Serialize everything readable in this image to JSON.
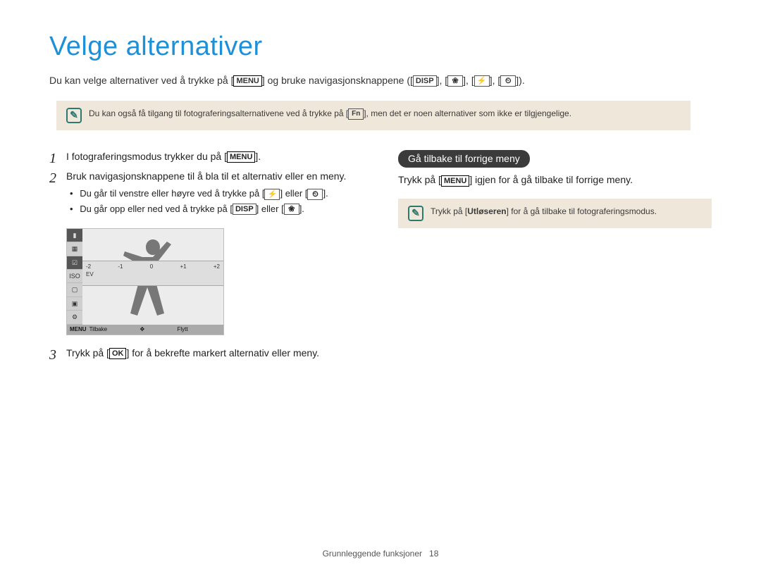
{
  "title": "Velge alternativer",
  "intro": {
    "part1": "Du kan velge alternativer ved å trykke på [",
    "menu": "MENU",
    "part2": "] og bruke navigasjonsknappene ([",
    "disp": "DISP",
    "part3": "], [",
    "macro": "❀",
    "part4": "], [",
    "flash": "⚡",
    "part5": "], [",
    "timer": "⏲",
    "part6": "])."
  },
  "note1": {
    "part1": "Du kan også få tilgang til fotograferingsalternativene ved å trykke på [",
    "fn": "Fn",
    "part2": "], men det er noen alternativer som ikke er tilgjengelige."
  },
  "steps": {
    "s1": {
      "num": "1",
      "text1": "I fotograferingsmodus trykker du på [",
      "menu": "MENU",
      "text2": "]."
    },
    "s2": {
      "num": "2",
      "text": "Bruk navigasjonsknappene til å bla til et alternativ eller en meny.",
      "b1a": "Du går til venstre eller høyre ved å trykke på [",
      "b1_icon1": "⚡",
      "b1b": "] eller [",
      "b1_icon2": "⏲",
      "b1c": "].",
      "b2a": "Du går opp eller ned ved å trykke på [",
      "b2_icon1": "DISP",
      "b2b": "] eller [",
      "b2_icon2": "❀",
      "b2c": "]."
    },
    "s3": {
      "num": "3",
      "text1": "Trykk på [",
      "ok": "OK",
      "text2": "] for å bekrefte markert alternativ eller meny."
    }
  },
  "screen": {
    "ev_scale": [
      "-2",
      "-1",
      "0",
      "+1",
      "+2"
    ],
    "ev_label": "EV",
    "bottom_left_label": "MENU",
    "bottom_left_text": "Tilbake",
    "bottom_mid_icon": "✥",
    "bottom_mid_text": "Flytt",
    "sidebar": [
      "▮",
      "▦",
      "☑",
      "ISO",
      "▢",
      "▣",
      "⚙"
    ]
  },
  "right": {
    "heading": "Gå tilbake til forrige meny",
    "text1": "Trykk på [",
    "menu": "MENU",
    "text2": "] igjen for å gå tilbake til forrige meny.",
    "note_text1": "Trykk på [",
    "note_bold": "Utløseren",
    "note_text2": "] for å gå tilbake til fotograferingsmodus."
  },
  "footer": {
    "text": "Grunnleggende funksjoner",
    "page": "18"
  }
}
